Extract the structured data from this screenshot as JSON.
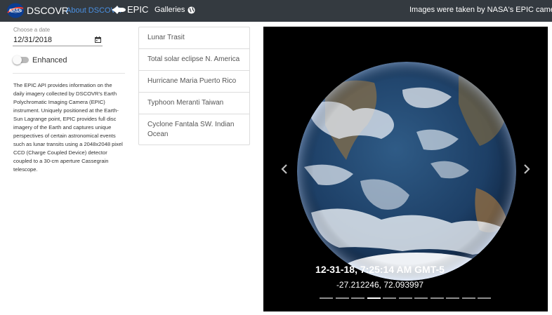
{
  "navbar": {
    "brand": "DSCOVR",
    "about_label": "About DSCOVR",
    "epic_label": "EPIC",
    "galleries_label": "Galleries",
    "note": "Images were taken by NASA's EPIC camera onboard the NOAA DSCOVR spacecraft"
  },
  "date_picker": {
    "label": "Choose a date",
    "value": "12/31/2018"
  },
  "enhanced_toggle": {
    "label": "Enhanced",
    "checked": false
  },
  "description": "The EPIC API provides information on the daily imagery collected by DSCOVR's Earth Polychromatic Imaging Camera (EPIC) instrument. Uniquely positioned at the Earth-Sun Lagrange point, EPIC provides full disc imagery of the Earth and captures unique perspectives of certain astronomical events such as lunar transits using a 2048x2048 pixel CCD (Charge Coupled Device) detector coupled to a 30-cm aperture Cassegrain telescope.",
  "galleries": [
    {
      "label": "Lunar Trasit"
    },
    {
      "label": "Total solar eclipse N. America"
    },
    {
      "label": "Hurricane Maria Puerto Rico"
    },
    {
      "label": "Typhoon Meranti Taiwan"
    },
    {
      "label": "Cyclone Fantala SW. Indian Ocean"
    }
  ],
  "carousel": {
    "caption_date": "12-31-18, 7:25:14 AM GMT-5",
    "caption_coords": "-27.212246, 72.093997",
    "slide_count": 11,
    "active_slide": 3
  },
  "colors": {
    "navbar_bg": "#343a40",
    "link_blue": "#4a90e2",
    "carousel_bg": "#000000"
  },
  "icons": [
    "nasa-logo",
    "shuttle-icon",
    "globe-icon",
    "calendar-icon",
    "chevron-left-icon",
    "chevron-right-icon"
  ]
}
